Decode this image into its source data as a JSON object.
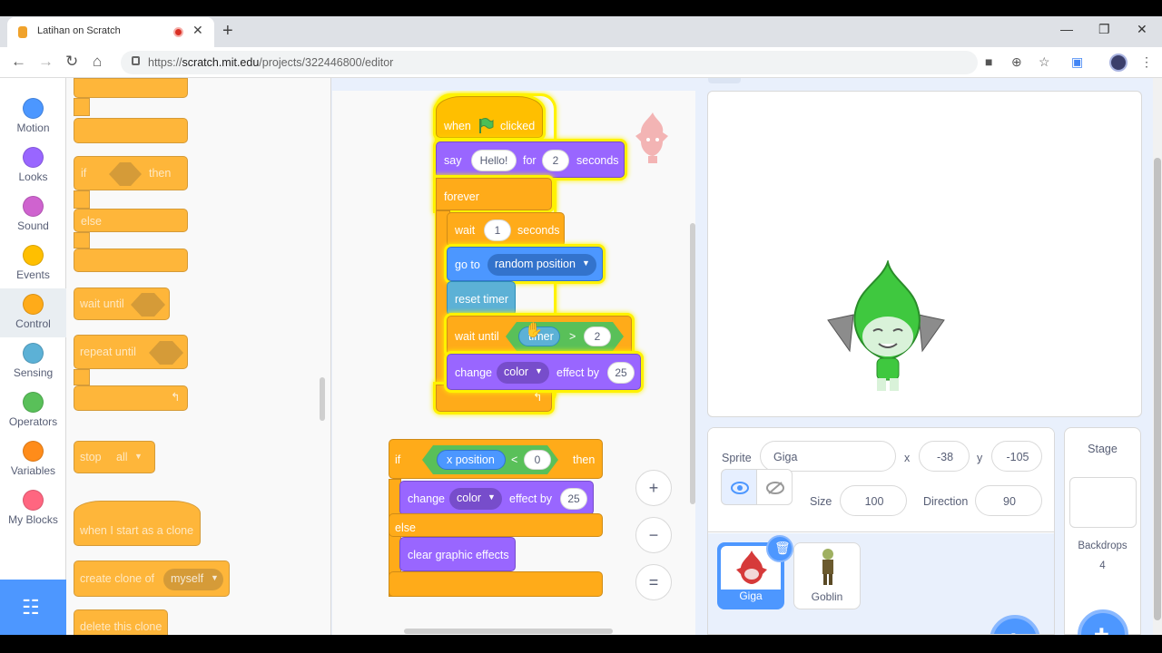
{
  "browser": {
    "tab_title": "Latihan on Scratch",
    "new_tab": "+",
    "url_scheme": "https://",
    "url_host": "scratch.mit.edu",
    "url_path": "/projects/322446800/editor"
  },
  "categories": [
    {
      "label": "Motion",
      "color": "#4c97ff"
    },
    {
      "label": "Looks",
      "color": "#9966ff"
    },
    {
      "label": "Sound",
      "color": "#cf63cf"
    },
    {
      "label": "Events",
      "color": "#ffbf00"
    },
    {
      "label": "Control",
      "color": "#ffab19"
    },
    {
      "label": "Sensing",
      "color": "#5cb1d6"
    },
    {
      "label": "Operators",
      "color": "#59c059"
    },
    {
      "label": "Variables",
      "color": "#ff8c1a"
    },
    {
      "label": "My Blocks",
      "color": "#ff6680"
    }
  ],
  "palette": {
    "if": "if",
    "then": "then",
    "else": "else",
    "wait_until": "wait until",
    "repeat_until": "repeat until",
    "stop": "stop",
    "stop_opt": "all",
    "start_clone": "when I start as a clone",
    "create_clone": "create clone of",
    "create_clone_opt": "myself",
    "delete_clone": "delete this clone"
  },
  "script1": {
    "when": "when",
    "clicked": "clicked",
    "say": "say",
    "say_text": "Hello!",
    "for": "for",
    "say_secs": "2",
    "seconds": "seconds",
    "forever": "forever",
    "wait": "wait",
    "wait_secs": "1",
    "goto": "go to",
    "goto_opt": "random position",
    "reset_timer": "reset timer",
    "wait_until": "wait until",
    "timer": "timer",
    "gt": ">",
    "gt_val": "2",
    "change": "change",
    "effect": "color",
    "effect_by": "effect by",
    "effect_val": "25"
  },
  "script2": {
    "if": "if",
    "xpos": "x position",
    "lt": "<",
    "lt_val": "0",
    "then": "then",
    "change": "change",
    "effect": "color",
    "effect_by": "effect by",
    "effect_val": "25",
    "else": "else",
    "clear": "clear graphic effects"
  },
  "zoom": {
    "in": "+",
    "out": "−",
    "reset": "="
  },
  "sprite_info": {
    "sprite_label": "Sprite",
    "sprite_name": "Giga",
    "x_label": "x",
    "x_val": "-38",
    "y_label": "y",
    "y_val": "-105",
    "size_label": "Size",
    "size_val": "100",
    "direction_label": "Direction",
    "direction_val": "90"
  },
  "sprites": [
    {
      "name": "Giga"
    },
    {
      "name": "Goblin"
    }
  ],
  "stage_pane": {
    "title": "Stage",
    "backdrops_label": "Backdrops",
    "backdrops_count": "4"
  },
  "colors": {
    "accent": "#4d97ff",
    "control": "#ffab19",
    "glow": "#fff200"
  }
}
